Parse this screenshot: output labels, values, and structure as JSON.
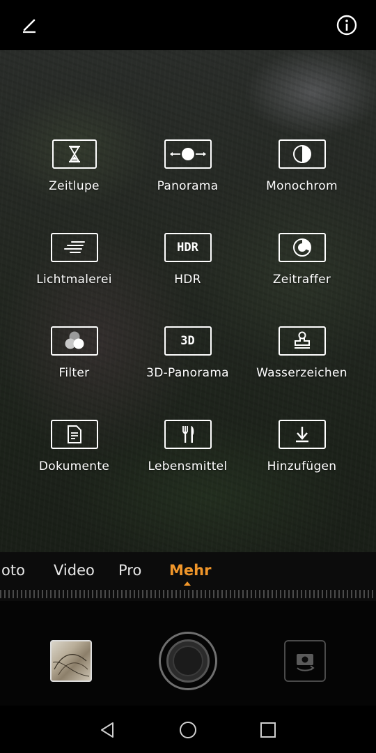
{
  "top": {
    "edit_icon": "pencil-icon",
    "info_icon": "info-icon"
  },
  "modes": [
    {
      "label": "Zeitlupe",
      "icon": "hourglass-icon"
    },
    {
      "label": "Panorama",
      "icon": "panorama-icon"
    },
    {
      "label": "Monochrom",
      "icon": "half-circle-icon"
    },
    {
      "label": "Lichtmalerei",
      "icon": "light-streak-icon"
    },
    {
      "label": "HDR",
      "icon": "hdr-icon",
      "tile_text": "HDR"
    },
    {
      "label": "Zeitraffer",
      "icon": "timelapse-icon"
    },
    {
      "label": "Filter",
      "icon": "filter-circles-icon"
    },
    {
      "label": "3D-Panorama",
      "icon": "3d-icon",
      "tile_text": "3D"
    },
    {
      "label": "Wasserzeichen",
      "icon": "stamp-icon"
    },
    {
      "label": "Dokumente",
      "icon": "document-icon"
    },
    {
      "label": "Lebensmittel",
      "icon": "fork-knife-icon"
    },
    {
      "label": "Hinzufügen",
      "icon": "download-icon"
    }
  ],
  "modebar": {
    "tabs": [
      "oto",
      "Video",
      "Pro",
      "Mehr"
    ],
    "active": "Mehr",
    "accent": "#f0962a"
  },
  "controls": {
    "gallery": "gallery-thumbnail",
    "shutter": "shutter-button",
    "switch": "switch-camera-icon"
  },
  "nav": {
    "back": "back-triangle-icon",
    "home": "home-circle-icon",
    "recents": "recents-square-icon"
  }
}
